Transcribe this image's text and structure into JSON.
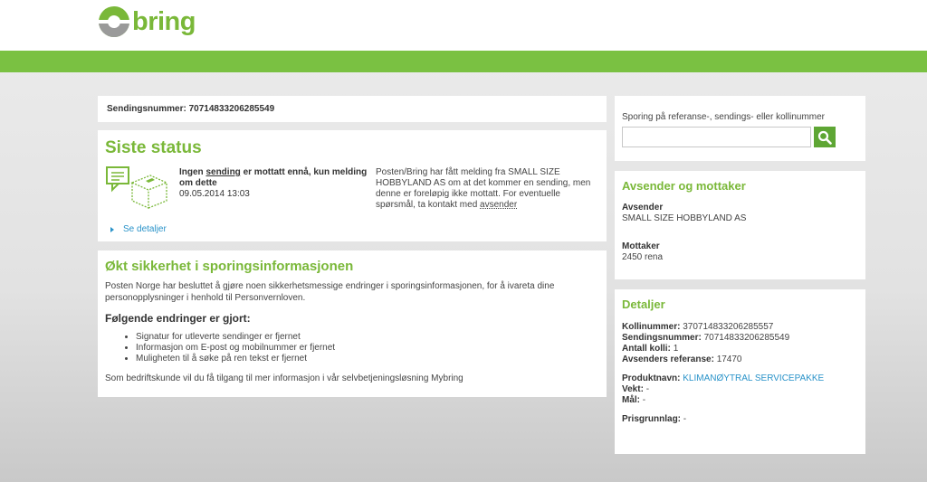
{
  "header": {
    "logo_text": "bring"
  },
  "shipment": {
    "label": "Sendingsnummer:",
    "number": "70714833206285549"
  },
  "status": {
    "title": "Siste status",
    "message_pre": "Ingen ",
    "message_link": "sending",
    "message_post": " er mottatt ennå, kun melding om dette",
    "timestamp": "09.05.2014 13:03",
    "note_text": "Posten/Bring har fått melding fra SMALL SIZE HOBBYLAND AS om at det kommer en sending, men denne er foreløpig ikke mottatt. For eventuelle spørsmål, ta kontakt med ",
    "note_link": "avsender",
    "details_link": "Se detaljer"
  },
  "security": {
    "title": "Økt sikkerhet i sporingsinformasjonen",
    "intro": "Posten Norge har besluttet å gjøre noen sikkerhetsmessige endringer i sporingsinformasjonen, for å ivareta dine personopplysninger i henhold til Personvernloven.",
    "subtitle": "Følgende endringer er gjort:",
    "items": [
      "Signatur for utleverte sendinger er fjernet",
      "Informasjon om E-post og mobilnummer er fjernet",
      "Muligheten til å søke på ren tekst er fjernet"
    ],
    "footer": "Som bedriftskunde vil du få tilgang til mer informasjon i vår selvbetjeningsløsning Mybring"
  },
  "search": {
    "label": "Sporing på referanse-, sendings- eller kollinummer",
    "value": ""
  },
  "parties": {
    "title": "Avsender og mottaker",
    "sender_label": "Avsender",
    "sender_value": "SMALL SIZE HOBBYLAND AS",
    "receiver_label": "Mottaker",
    "receiver_value": "2450 rena"
  },
  "details": {
    "title": "Detaljer",
    "package_label": "Kollinummer:",
    "package_value": "370714833206285557",
    "shipment_label": "Sendingsnummer:",
    "shipment_value": "70714833206285549",
    "count_label": "Antall kolli:",
    "count_value": "1",
    "ref_label": "Avsenders referanse:",
    "ref_value": "17470",
    "product_label": "Produktnavn:",
    "product_value": "KLIMANØYTRAL SERVICEPAKKE",
    "weight_label": "Vekt:",
    "weight_value": "-",
    "dim_label": "Mål:",
    "dim_value": "-",
    "price_label": "Prisgrunnlag:",
    "price_value": "-"
  },
  "colors": {
    "brand_green": "#7ac142",
    "title_green": "#7ab839",
    "link_blue": "#2a93c9"
  }
}
